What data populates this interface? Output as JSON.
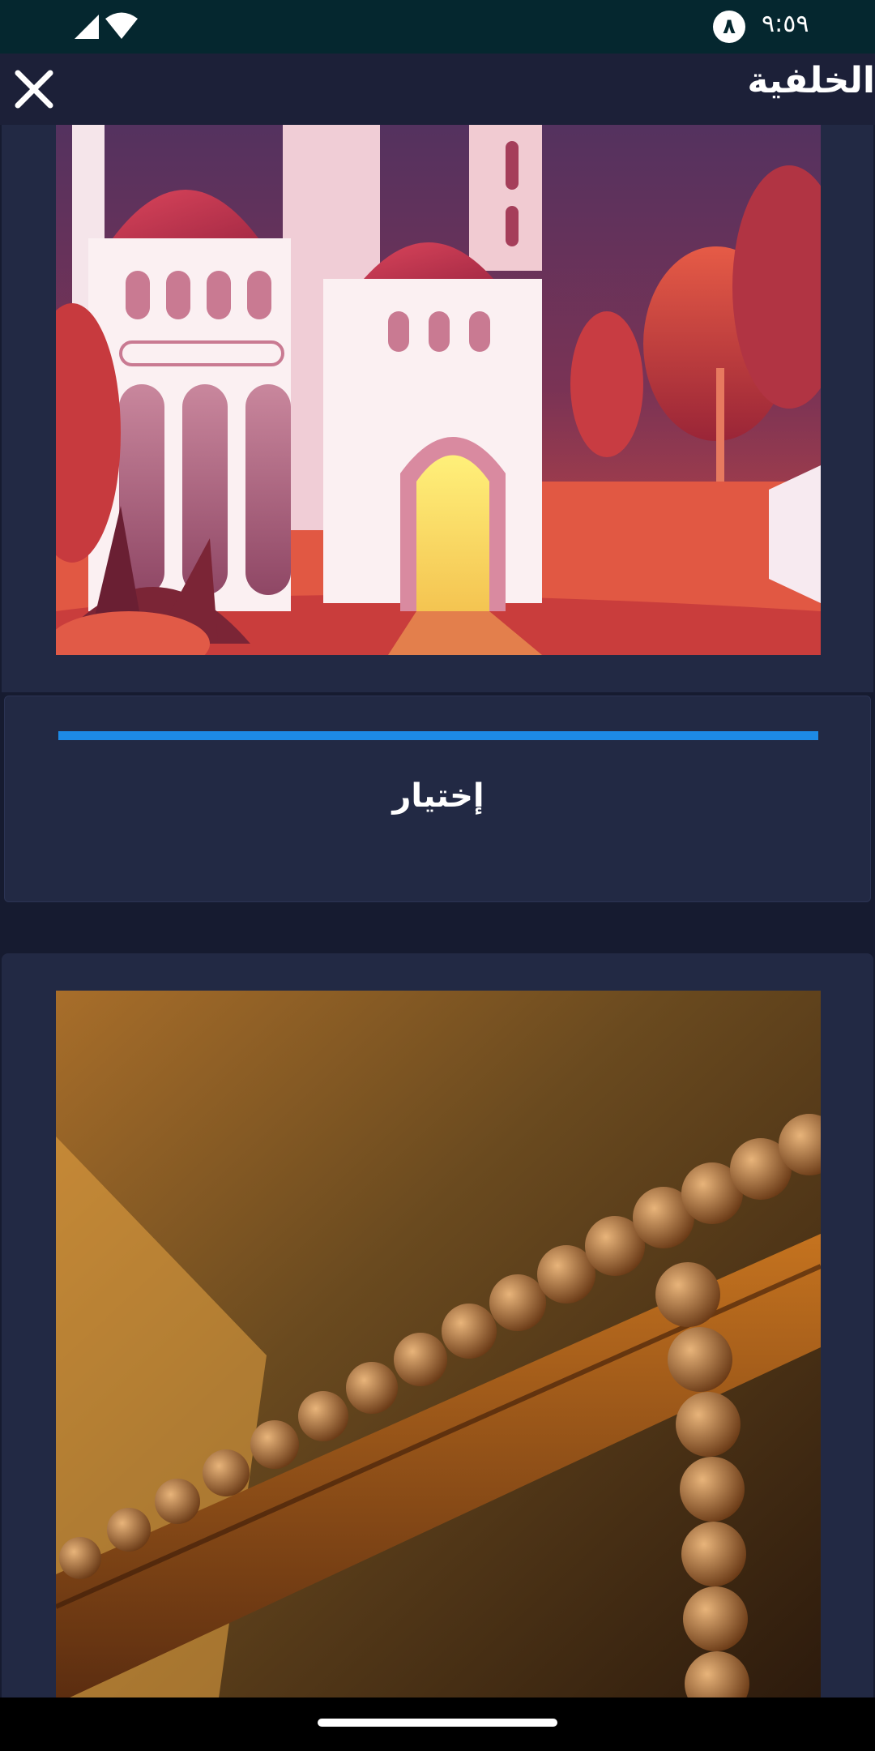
{
  "status_bar": {
    "time": "٩:٥٩",
    "badge_icon": "notification-badge-icon",
    "badge_text": "٨",
    "icons": [
      "signal-icon",
      "wifi-icon"
    ]
  },
  "app_bar": {
    "title": "الخلفية",
    "close_icon": "close-icon"
  },
  "backgrounds": [
    {
      "image": "mosque-illustration",
      "selected": true
    },
    {
      "image": "prayer-beads-photo",
      "selected": false
    }
  ],
  "select_panel": {
    "label": "إختيار",
    "progress": 1.0,
    "progress_color": "#1d8ae5"
  },
  "colors": {
    "status_bar": "#05272f",
    "app_bar": "#1c2038",
    "background": "#161b30",
    "card": "#222944",
    "accent": "#1d8ae5"
  }
}
